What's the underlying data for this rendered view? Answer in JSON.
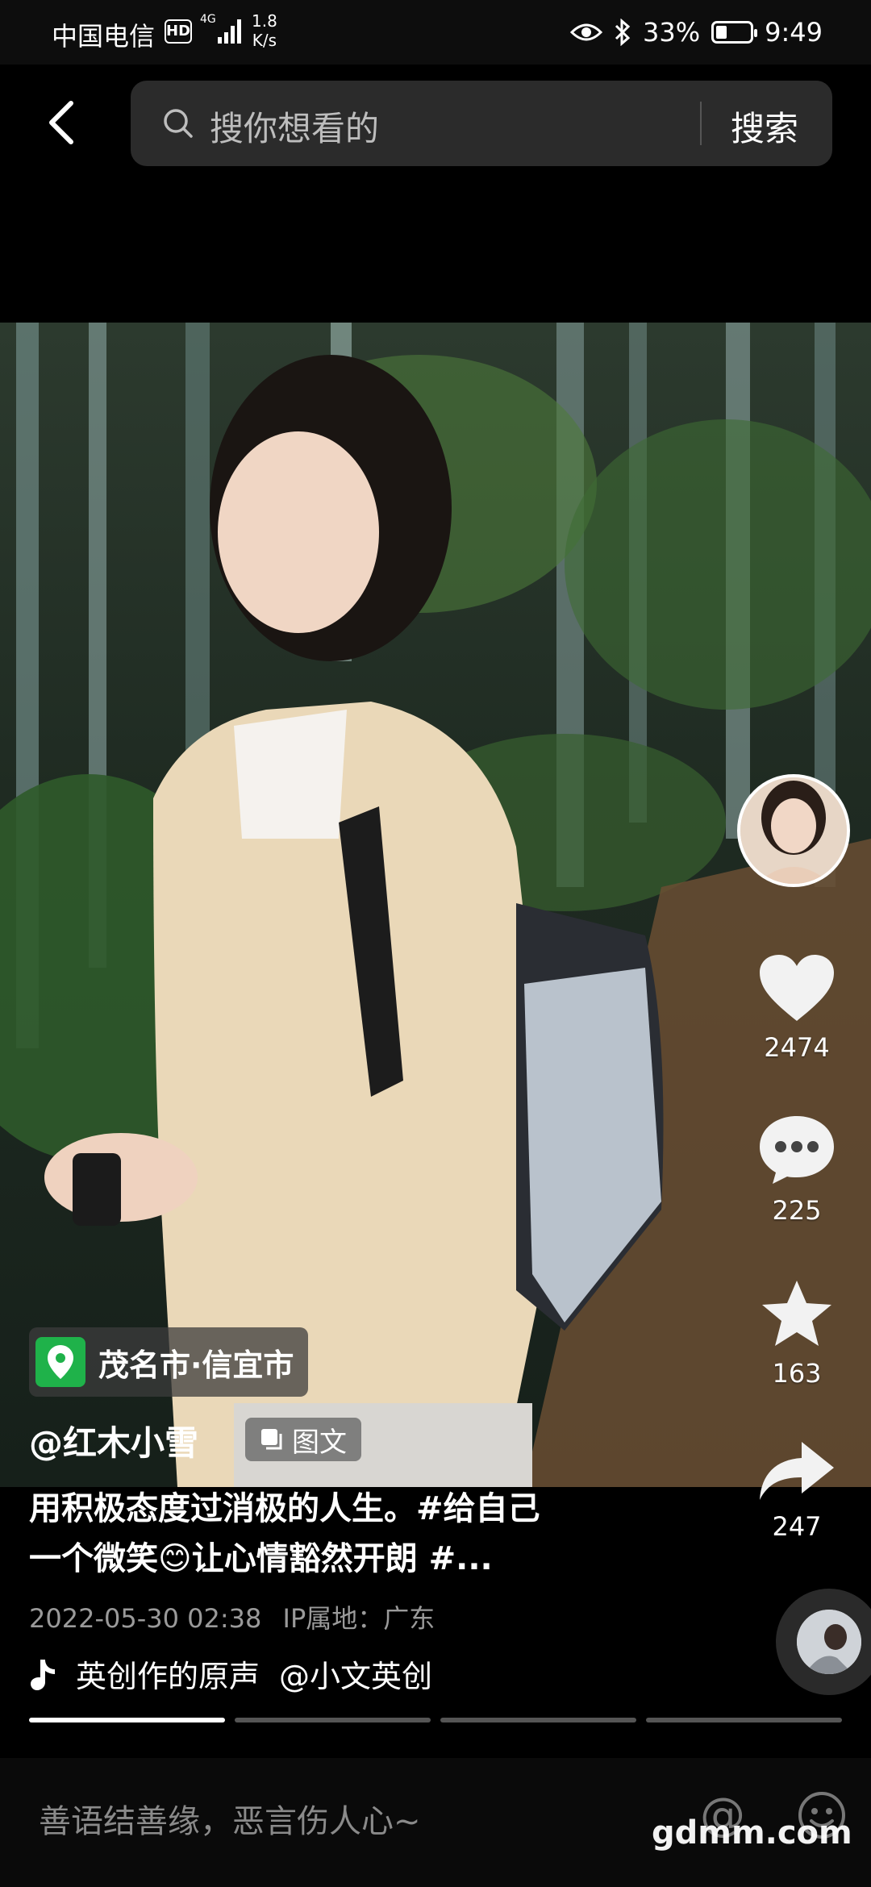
{
  "status_bar": {
    "carrier": "中国电信",
    "hd": "HD",
    "network": "4G",
    "speed_value": "1.8",
    "speed_unit": "K/s",
    "battery_percent": "33%",
    "battery_level": 0.33,
    "time": "9:49"
  },
  "search": {
    "placeholder": "搜你想看的",
    "button": "搜索"
  },
  "post": {
    "location": "茂名市·信宜市",
    "author": "@红木小雪",
    "type_tag": "图文",
    "caption_line1": "用积极态度过消极的人生。#给自己",
    "caption_line2": "一个微笑😊让心情豁然开朗 #...",
    "timestamp": "2022-05-30 02:38",
    "ip_location": "IP属地：广东",
    "music_title": "英创作的原声",
    "music_author": "@小文英创"
  },
  "actions": {
    "likes": "2474",
    "comments": "225",
    "favorites": "163",
    "shares": "247"
  },
  "progress": {
    "segments": 4,
    "current": 1
  },
  "comment_bar": {
    "placeholder": "善语结善缘，恶言伤人心~",
    "at": "@"
  },
  "watermark": "gdmm.com"
}
